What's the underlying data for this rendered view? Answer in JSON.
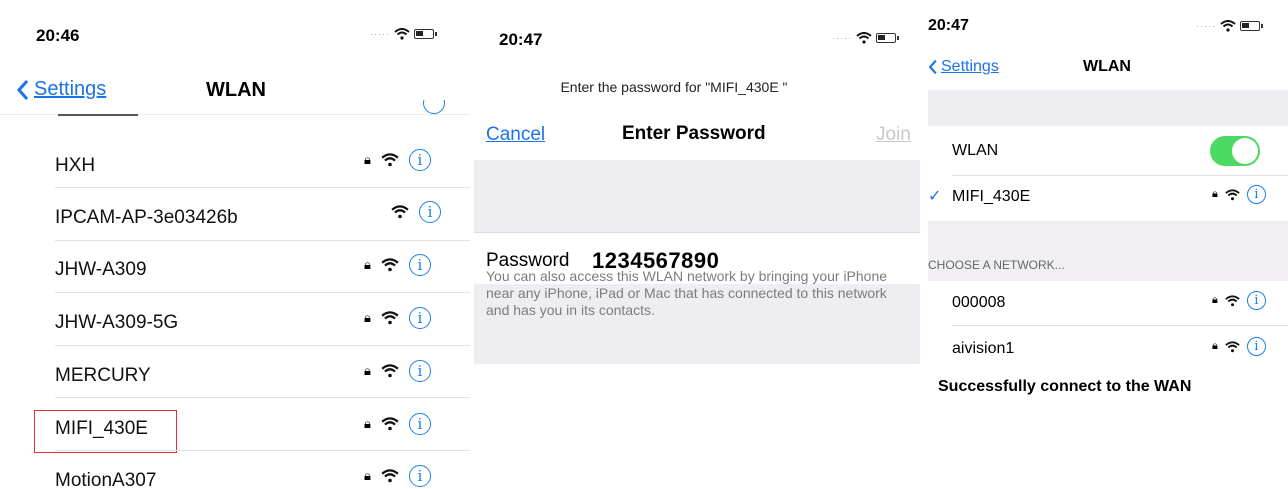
{
  "panel1": {
    "time": "20:46",
    "back_label": "Settings",
    "title": "WLAN",
    "networks": [
      {
        "name": "HXH",
        "locked": true
      },
      {
        "name": "IPCAM-AP-3e03426b",
        "locked": false
      },
      {
        "name": "JHW-A309",
        "locked": true
      },
      {
        "name": "JHW-A309-5G",
        "locked": true
      },
      {
        "name": "MERCURY",
        "locked": true
      },
      {
        "name": "MIFI_430E",
        "locked": true,
        "highlighted": true
      },
      {
        "name": "MotionA307",
        "locked": true
      }
    ],
    "highlight_color": "#e0302f"
  },
  "panel2": {
    "time": "20:47",
    "prompt": "Enter the password for \"MIFI_430E \"",
    "cancel_label": "Cancel",
    "title": "Enter Password",
    "join_label": "Join",
    "password_label": "Password",
    "password_value": "1234567890",
    "hint": "You can also access this WLAN network by bringing your iPhone near any iPhone, iPad or Mac that has connected to this network and has you in its contacts."
  },
  "panel3": {
    "time": "20:47",
    "back_label": "Settings",
    "title": "WLAN",
    "wlan_label": "WLAN",
    "wlan_on": true,
    "connected_network": "MIFI_430E",
    "section_header": "CHOOSE A NETWORK...",
    "networks": [
      {
        "name": "000008",
        "locked": true
      },
      {
        "name": "aivision1",
        "locked": true
      }
    ],
    "caption": "Successfully connect to the WAN",
    "toggle_color": "#4cd964"
  },
  "colors": {
    "accent": "#1a73e8",
    "info": "#1a7fe8"
  },
  "icons": [
    "chevron-left-icon",
    "lock-icon",
    "wifi-icon",
    "info-icon",
    "checkmark-icon",
    "battery-icon",
    "signal-dots-icon"
  ]
}
